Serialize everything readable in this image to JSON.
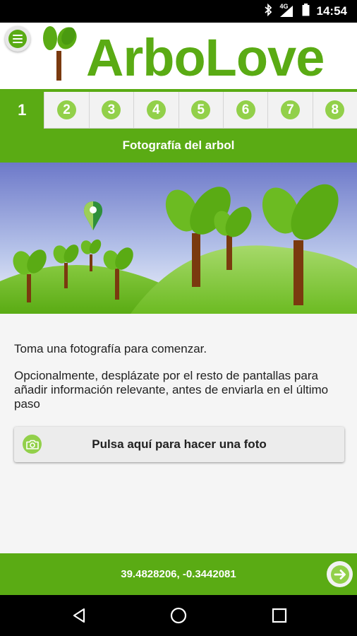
{
  "status_bar": {
    "time": "14:54",
    "network": "4G",
    "icons": [
      "bluetooth-icon",
      "signal-icon",
      "battery-icon"
    ]
  },
  "header": {
    "app_name": "ArboLove",
    "menu_icon": "hamburger-menu-icon",
    "logo_icon": "sapling-logo-icon"
  },
  "steps": {
    "active": "1",
    "items": [
      "1",
      "2",
      "3",
      "4",
      "5",
      "6",
      "7",
      "8"
    ]
  },
  "section": {
    "title": "Fotografía del arbol"
  },
  "banner": {
    "description_icon": "location-pin-icon"
  },
  "content": {
    "instructions": "Toma una fotografía para comenzar.",
    "optional_text": "Opcionalmente, desplázate por el resto de pantallas para añadir información relevante, antes de enviarla en el último paso",
    "photo_button_label": "Pulsa aquí para hacer una foto",
    "photo_button_icon": "camera-icon"
  },
  "footer": {
    "coordinates": "39.4828206, -0.3442081",
    "next_icon": "arrow-right-icon"
  },
  "nav_bar": {
    "icons": [
      "back-icon",
      "home-icon",
      "recents-icon"
    ]
  },
  "colors": {
    "primary_green": "#5aab14",
    "light_green": "#92d04a",
    "dark_green": "#3e8e0a"
  }
}
